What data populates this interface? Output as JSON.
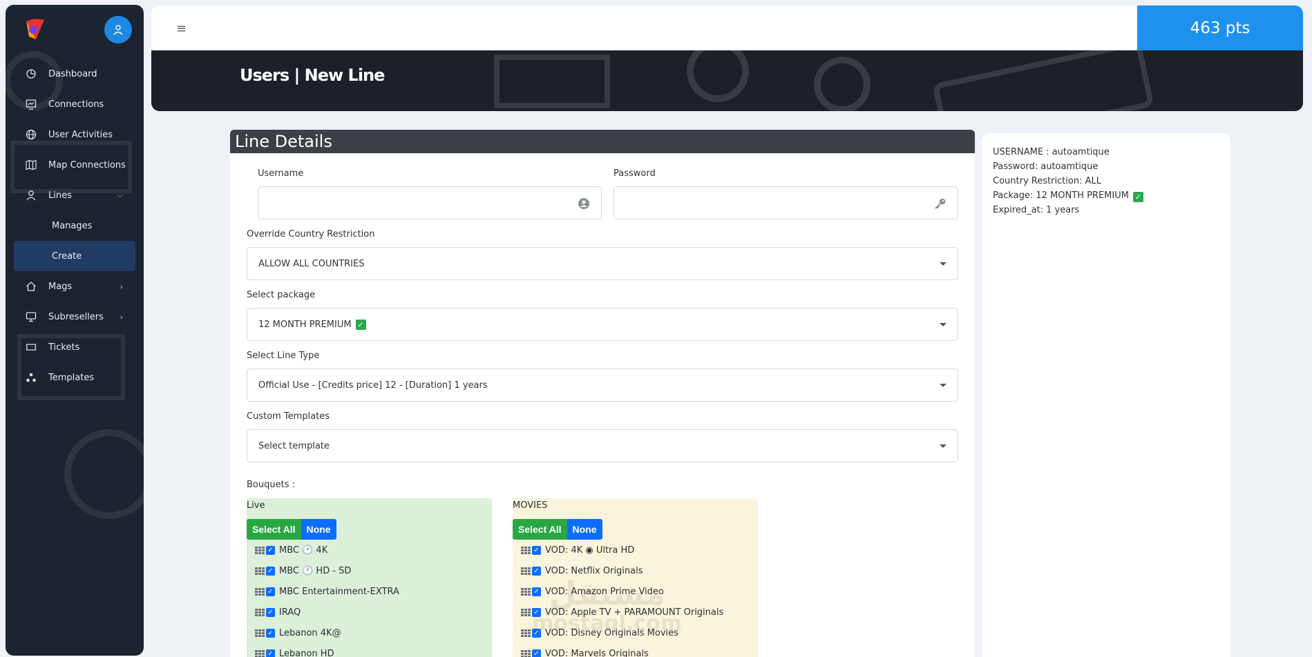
{
  "topbar": {
    "points": "463 pts"
  },
  "banner": {
    "title": "Users | New Line"
  },
  "sidebar": {
    "items": [
      {
        "label": "Dashboard",
        "icon": "dashboard-icon"
      },
      {
        "label": "Connections",
        "icon": "connections-icon"
      },
      {
        "label": "User Activities",
        "icon": "globe-icon"
      },
      {
        "label": "Map Connections",
        "icon": "map-icon"
      },
      {
        "label": "Lines",
        "icon": "user-icon"
      },
      {
        "label": "Manages"
      },
      {
        "label": "Create"
      },
      {
        "label": "Mags",
        "icon": "home-icon"
      },
      {
        "label": "Subresellers",
        "icon": "monitor-icon"
      },
      {
        "label": "Tickets",
        "icon": "ticket-icon"
      },
      {
        "label": "Templates",
        "icon": "templates-icon"
      }
    ]
  },
  "card": {
    "title": "Line Details",
    "username_label": "Username",
    "password_label": "Password",
    "country_label": "Override Country Restriction",
    "country_value": "ALLOW ALL COUNTRIES",
    "package_label": "Select package",
    "package_value": "12 MONTH PREMIUM",
    "linetype_label": "Select Line Type",
    "linetype_value": "Official Use - [Credits price] 12 - [Duration] 1 years",
    "templates_label": "Custom Templates",
    "templates_value": "Select template",
    "bouquets_label": "Bouquets :"
  },
  "bouquets": {
    "select_all": "Select All",
    "none": "None",
    "live": {
      "title": "Live",
      "items": [
        "MBC 🕐 4K",
        "MBC 🕐 HD - SD",
        "MBC Entertainment-EXTRA",
        "IRAQ",
        "Lebanon 4K@",
        "Lebanon HD"
      ]
    },
    "movies": {
      "title": "MOVIES",
      "items": [
        "VOD: 4K ◉ Ultra HD",
        "VOD: Netflix Originals",
        "VOD: Amazon Prime Video",
        "VOD: Apple TV + PARAMOUNT Originals",
        "VOD: Disney Originals Movies",
        "VOD: Marvels Originals"
      ]
    }
  },
  "summary": {
    "lines": [
      "USERNAME : autoamtique",
      "Password: autoamtique",
      "Country Restriction: ALL",
      "Package: 12 MONTH PREMIUM",
      "Expired_at: 1 years"
    ]
  },
  "watermark": {
    "arabic": "مستقل",
    "latin": "mostaql.com"
  },
  "colors": {
    "accent": "#1e90ee",
    "sidebar": "#1b2430",
    "success": "#29a745",
    "primary": "#0d6efd"
  }
}
